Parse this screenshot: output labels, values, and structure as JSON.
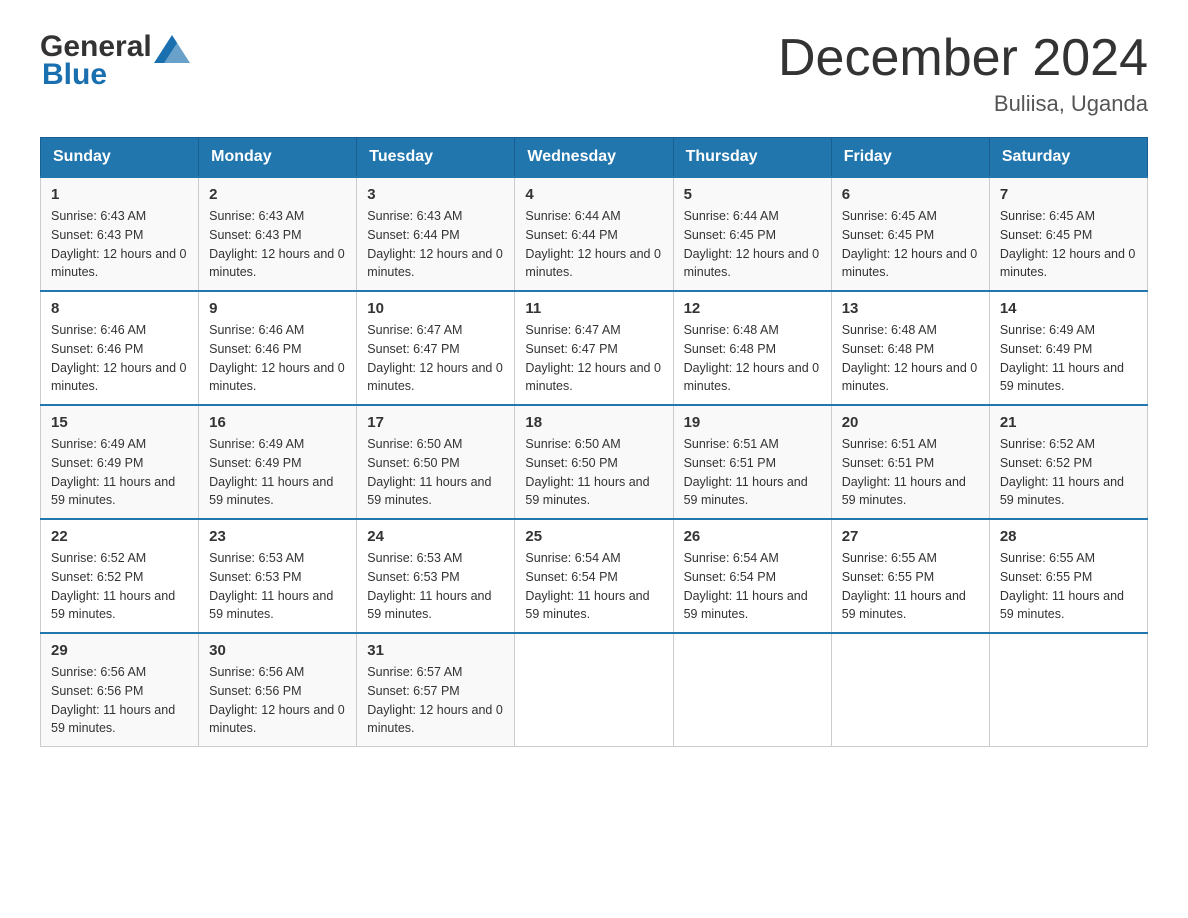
{
  "header": {
    "logo_general": "General",
    "logo_blue": "Blue",
    "month": "December 2024",
    "location": "Buliisa, Uganda"
  },
  "weekdays": [
    "Sunday",
    "Monday",
    "Tuesday",
    "Wednesday",
    "Thursday",
    "Friday",
    "Saturday"
  ],
  "weeks": [
    [
      {
        "day": "1",
        "sunrise": "6:43 AM",
        "sunset": "6:43 PM",
        "daylight": "12 hours and 0 minutes."
      },
      {
        "day": "2",
        "sunrise": "6:43 AM",
        "sunset": "6:43 PM",
        "daylight": "12 hours and 0 minutes."
      },
      {
        "day": "3",
        "sunrise": "6:43 AM",
        "sunset": "6:44 PM",
        "daylight": "12 hours and 0 minutes."
      },
      {
        "day": "4",
        "sunrise": "6:44 AM",
        "sunset": "6:44 PM",
        "daylight": "12 hours and 0 minutes."
      },
      {
        "day": "5",
        "sunrise": "6:44 AM",
        "sunset": "6:45 PM",
        "daylight": "12 hours and 0 minutes."
      },
      {
        "day": "6",
        "sunrise": "6:45 AM",
        "sunset": "6:45 PM",
        "daylight": "12 hours and 0 minutes."
      },
      {
        "day": "7",
        "sunrise": "6:45 AM",
        "sunset": "6:45 PM",
        "daylight": "12 hours and 0 minutes."
      }
    ],
    [
      {
        "day": "8",
        "sunrise": "6:46 AM",
        "sunset": "6:46 PM",
        "daylight": "12 hours and 0 minutes."
      },
      {
        "day": "9",
        "sunrise": "6:46 AM",
        "sunset": "6:46 PM",
        "daylight": "12 hours and 0 minutes."
      },
      {
        "day": "10",
        "sunrise": "6:47 AM",
        "sunset": "6:47 PM",
        "daylight": "12 hours and 0 minutes."
      },
      {
        "day": "11",
        "sunrise": "6:47 AM",
        "sunset": "6:47 PM",
        "daylight": "12 hours and 0 minutes."
      },
      {
        "day": "12",
        "sunrise": "6:48 AM",
        "sunset": "6:48 PM",
        "daylight": "12 hours and 0 minutes."
      },
      {
        "day": "13",
        "sunrise": "6:48 AM",
        "sunset": "6:48 PM",
        "daylight": "12 hours and 0 minutes."
      },
      {
        "day": "14",
        "sunrise": "6:49 AM",
        "sunset": "6:49 PM",
        "daylight": "11 hours and 59 minutes."
      }
    ],
    [
      {
        "day": "15",
        "sunrise": "6:49 AM",
        "sunset": "6:49 PM",
        "daylight": "11 hours and 59 minutes."
      },
      {
        "day": "16",
        "sunrise": "6:49 AM",
        "sunset": "6:49 PM",
        "daylight": "11 hours and 59 minutes."
      },
      {
        "day": "17",
        "sunrise": "6:50 AM",
        "sunset": "6:50 PM",
        "daylight": "11 hours and 59 minutes."
      },
      {
        "day": "18",
        "sunrise": "6:50 AM",
        "sunset": "6:50 PM",
        "daylight": "11 hours and 59 minutes."
      },
      {
        "day": "19",
        "sunrise": "6:51 AM",
        "sunset": "6:51 PM",
        "daylight": "11 hours and 59 minutes."
      },
      {
        "day": "20",
        "sunrise": "6:51 AM",
        "sunset": "6:51 PM",
        "daylight": "11 hours and 59 minutes."
      },
      {
        "day": "21",
        "sunrise": "6:52 AM",
        "sunset": "6:52 PM",
        "daylight": "11 hours and 59 minutes."
      }
    ],
    [
      {
        "day": "22",
        "sunrise": "6:52 AM",
        "sunset": "6:52 PM",
        "daylight": "11 hours and 59 minutes."
      },
      {
        "day": "23",
        "sunrise": "6:53 AM",
        "sunset": "6:53 PM",
        "daylight": "11 hours and 59 minutes."
      },
      {
        "day": "24",
        "sunrise": "6:53 AM",
        "sunset": "6:53 PM",
        "daylight": "11 hours and 59 minutes."
      },
      {
        "day": "25",
        "sunrise": "6:54 AM",
        "sunset": "6:54 PM",
        "daylight": "11 hours and 59 minutes."
      },
      {
        "day": "26",
        "sunrise": "6:54 AM",
        "sunset": "6:54 PM",
        "daylight": "11 hours and 59 minutes."
      },
      {
        "day": "27",
        "sunrise": "6:55 AM",
        "sunset": "6:55 PM",
        "daylight": "11 hours and 59 minutes."
      },
      {
        "day": "28",
        "sunrise": "6:55 AM",
        "sunset": "6:55 PM",
        "daylight": "11 hours and 59 minutes."
      }
    ],
    [
      {
        "day": "29",
        "sunrise": "6:56 AM",
        "sunset": "6:56 PM",
        "daylight": "11 hours and 59 minutes."
      },
      {
        "day": "30",
        "sunrise": "6:56 AM",
        "sunset": "6:56 PM",
        "daylight": "12 hours and 0 minutes."
      },
      {
        "day": "31",
        "sunrise": "6:57 AM",
        "sunset": "6:57 PM",
        "daylight": "12 hours and 0 minutes."
      },
      null,
      null,
      null,
      null
    ]
  ]
}
